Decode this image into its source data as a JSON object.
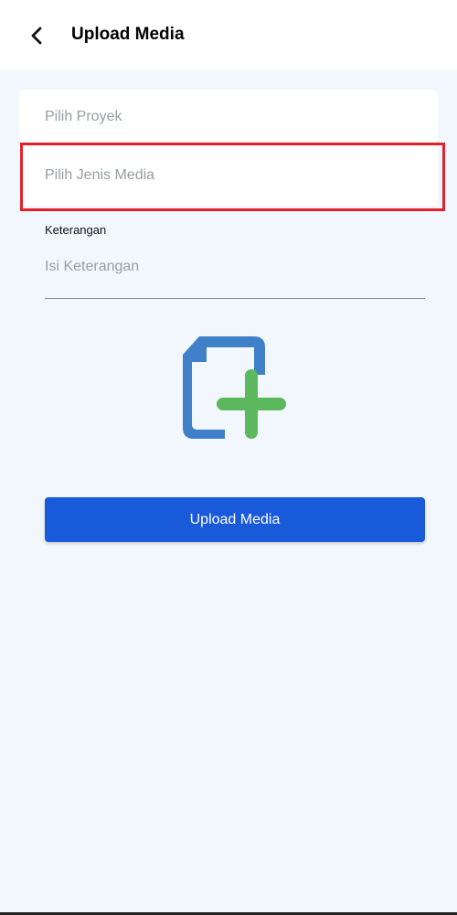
{
  "header": {
    "title": "Upload Media",
    "back_icon": "chevron-left-icon"
  },
  "form": {
    "project_select_placeholder": "Pilih Proyek",
    "media_type_select_placeholder": "Pilih Jenis Media",
    "description_label": "Keterangan",
    "description_placeholder": "Isi Keterangan",
    "description_value": "",
    "add_file_icon": "add-file-icon",
    "upload_button_label": "Upload Media"
  },
  "colors": {
    "background": "#f1f7fd",
    "primary": "#195ada",
    "file_icon": "#3f80c8",
    "plus_icon": "#5cb85c",
    "highlight": "#e4202a"
  }
}
